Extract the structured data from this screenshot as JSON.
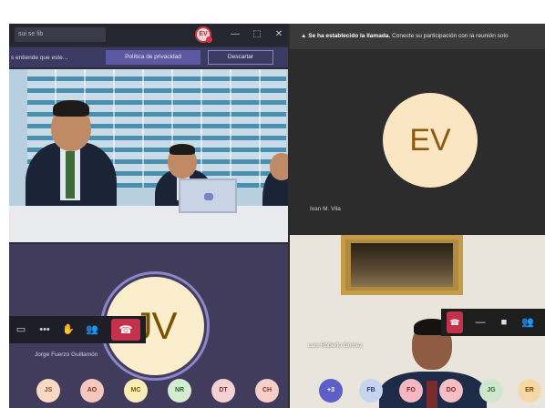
{
  "left_window": {
    "title": "sui se lib",
    "account_initials": "EV",
    "window_controls": {
      "minimize": "—",
      "maximize": "⬚",
      "close": "✕"
    },
    "banner": {
      "message": "s entiende que este...",
      "privacy_button": "Política de privacidad",
      "discard_button": "Descartar"
    },
    "video_caption": "",
    "jv_tile": {
      "initials": "JV",
      "name": "Jorge Fuerzo Guillamón"
    },
    "call_controls": {
      "video": "▭",
      "more": "•••",
      "raise_hand": "✋",
      "participants": "👥",
      "hangup": "☎"
    },
    "avatars": [
      {
        "initials": "JS",
        "bg": "#f7d9c4",
        "fg": "#8a4a20"
      },
      {
        "initials": "AO",
        "bg": "#f4c8bf",
        "fg": "#8a2e1e"
      },
      {
        "initials": "MC",
        "bg": "#faecb8",
        "fg": "#7a5a00"
      },
      {
        "initials": "NR",
        "bg": "#d4ecd0",
        "fg": "#2c6a2a"
      },
      {
        "initials": "DT",
        "bg": "#f2d2d2",
        "fg": "#8a2a2a"
      },
      {
        "initials": "CH",
        "bg": "#f6d0c8",
        "fg": "#8a3020"
      }
    ]
  },
  "right_window": {
    "notice": {
      "bold": "Se ha establecido la llamada.",
      "text": "Conecte su participación con la reunión solo"
    },
    "ev_tile": {
      "initials": "EV",
      "name": "Ivan M. Vila"
    },
    "man_tile": {
      "name": "Luis Roberto Gómez"
    },
    "call_controls": {
      "hangup": "☎",
      "minus": "—",
      "video": "■",
      "participants": "👥"
    },
    "avatars": [
      {
        "initials": "+3",
        "bg": "#5b5fc7",
        "fg": "#ffffff"
      },
      {
        "initials": "FB",
        "bg": "#c7d4f0",
        "fg": "#2a3c7a"
      },
      {
        "initials": "FO",
        "bg": "#f3b8c2",
        "fg": "#8a1e30"
      },
      {
        "initials": "DO",
        "bg": "#f4bfc2",
        "fg": "#8a1e26"
      },
      {
        "initials": "JG",
        "bg": "#cfe6cf",
        "fg": "#2a6a2a"
      },
      {
        "initials": "ER",
        "bg": "#f6d8a8",
        "fg": "#7a4a00"
      }
    ]
  }
}
